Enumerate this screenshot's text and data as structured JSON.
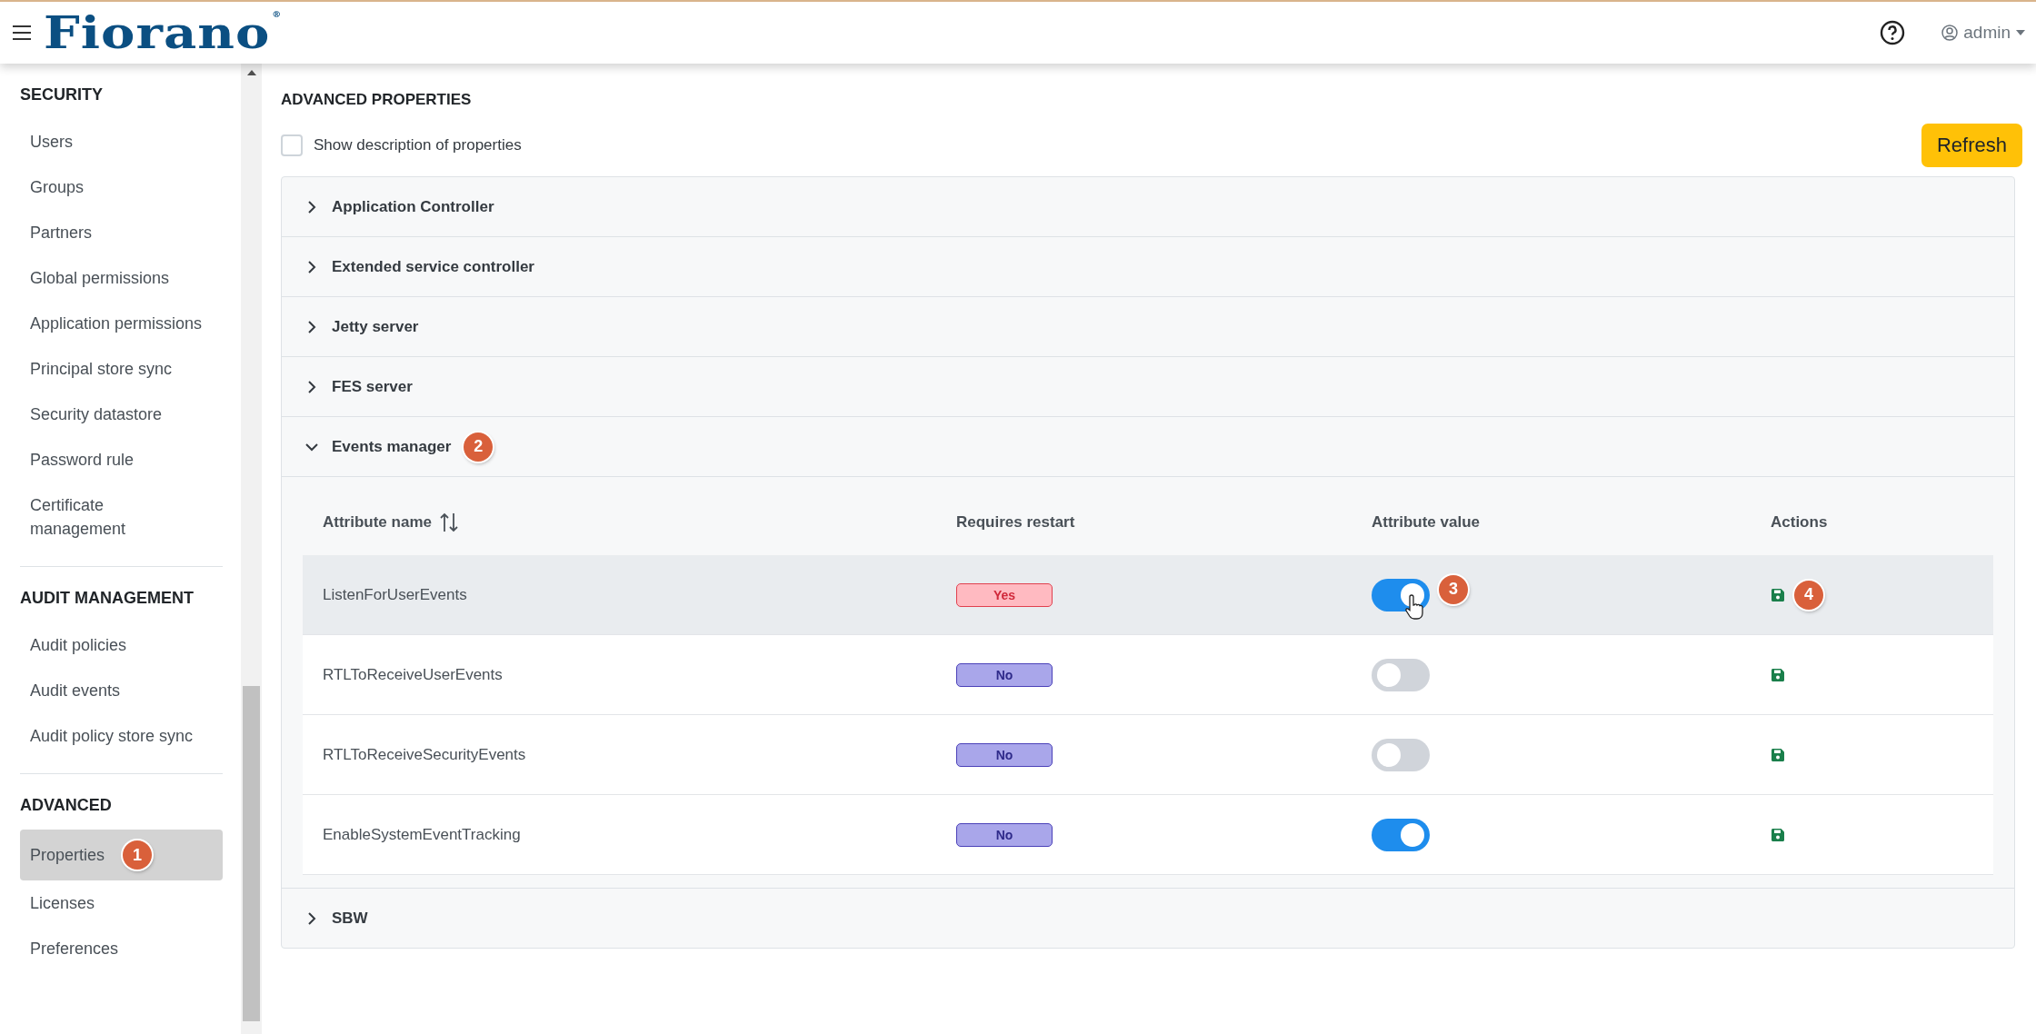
{
  "header": {
    "logo": "Fiorano",
    "logo_mark": "®",
    "user": "admin"
  },
  "sidebar": {
    "sections": [
      {
        "title": "SECURITY",
        "items": [
          {
            "label": "Users",
            "selected": false
          },
          {
            "label": "Groups",
            "selected": false
          },
          {
            "label": "Partners",
            "selected": false
          },
          {
            "label": "Global permissions",
            "selected": false
          },
          {
            "label": "Application permissions",
            "selected": false
          },
          {
            "label": "Principal store sync",
            "selected": false
          },
          {
            "label": "Security datastore",
            "selected": false
          },
          {
            "label": "Password rule",
            "selected": false
          },
          {
            "label": "Certificate\nmanagement",
            "selected": false
          }
        ]
      },
      {
        "title": "AUDIT MANAGEMENT",
        "items": [
          {
            "label": "Audit policies",
            "selected": false
          },
          {
            "label": "Audit events",
            "selected": false
          },
          {
            "label": "Audit policy store sync",
            "selected": false
          }
        ]
      },
      {
        "title": "ADVANCED",
        "items": [
          {
            "label": "Properties",
            "selected": true,
            "callout": "1"
          },
          {
            "label": "Licenses",
            "selected": false
          },
          {
            "label": "Preferences",
            "selected": false
          }
        ]
      }
    ]
  },
  "main": {
    "title": "ADVANCED PROPERTIES",
    "show_description": {
      "label": "Show description of properties",
      "checked": false
    },
    "refresh": "Refresh",
    "sections": [
      {
        "title": "Application Controller",
        "expanded": false
      },
      {
        "title": "Extended service controller",
        "expanded": false
      },
      {
        "title": "Jetty server",
        "expanded": false
      },
      {
        "title": "FES server",
        "expanded": false
      },
      {
        "title": "Events manager",
        "expanded": true,
        "callout": "2",
        "table": {
          "columns": [
            "Attribute name",
            "Requires restart",
            "Attribute value",
            "Actions"
          ],
          "rows": [
            {
              "name": "ListenForUserEvents",
              "restart": "Yes",
              "restart_required": true,
              "on": true,
              "hovered": true,
              "value_callout": "3",
              "action_callout": "4"
            },
            {
              "name": "RTLToReceiveUserEvents",
              "restart": "No",
              "restart_required": false,
              "on": false,
              "hovered": false
            },
            {
              "name": "RTLToReceiveSecurityEvents",
              "restart": "No",
              "restart_required": false,
              "on": false,
              "hovered": false
            },
            {
              "name": "EnableSystemEventTracking",
              "restart": "No",
              "restart_required": false,
              "on": true,
              "hovered": false
            }
          ]
        }
      },
      {
        "title": "SBW",
        "expanded": false
      }
    ]
  }
}
